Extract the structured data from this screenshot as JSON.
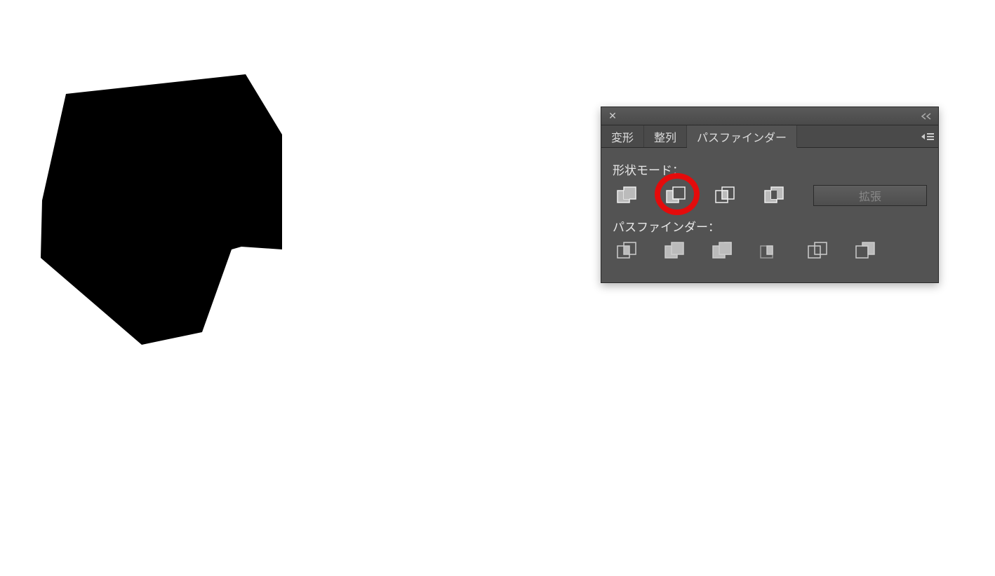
{
  "canvas": {
    "shape": "black-polygon"
  },
  "panel": {
    "tabs": [
      {
        "label": "変形"
      },
      {
        "label": "整列"
      },
      {
        "label": "パスファインダー"
      }
    ],
    "activeTab": 2,
    "section1": {
      "label": "形状モード：",
      "expand_label": "拡張"
    },
    "section2": {
      "label": "パスファインダー："
    },
    "shapeModes": [
      {
        "name": "unite"
      },
      {
        "name": "minus-front"
      },
      {
        "name": "intersect"
      },
      {
        "name": "exclude"
      }
    ],
    "pathfinders": [
      {
        "name": "divide"
      },
      {
        "name": "trim"
      },
      {
        "name": "merge"
      },
      {
        "name": "crop"
      },
      {
        "name": "outline"
      },
      {
        "name": "minus-back"
      }
    ],
    "highlightIndex": 1
  }
}
